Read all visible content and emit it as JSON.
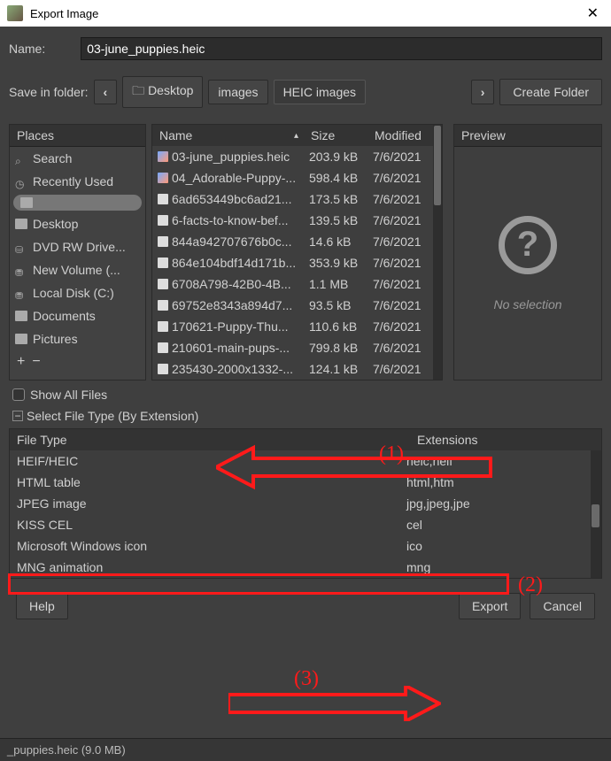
{
  "window": {
    "title": "Export Image"
  },
  "name_label": "Name:",
  "name_value": "03-june_puppies.heic",
  "savein_label": "Save in folder:",
  "breadcrumbs": [
    "Desktop",
    "images",
    "HEIC images"
  ],
  "create_folder": "Create Folder",
  "places_header": "Places",
  "places": [
    {
      "icon": "search",
      "label": "Search"
    },
    {
      "icon": "clock",
      "label": "Recently Used"
    },
    {
      "icon": "folder",
      "label": ""
    },
    {
      "icon": "folder",
      "label": "Desktop"
    },
    {
      "icon": "disk",
      "label": "DVD RW Drive..."
    },
    {
      "icon": "drive",
      "label": "New Volume (..."
    },
    {
      "icon": "drive",
      "label": "Local Disk (C:)"
    },
    {
      "icon": "folder",
      "label": "Documents"
    },
    {
      "icon": "folder",
      "label": "Pictures"
    }
  ],
  "file_headers": {
    "name": "Name",
    "size": "Size",
    "modified": "Modified"
  },
  "files": [
    {
      "icon": "img",
      "name": "03-june_puppies.heic",
      "size": "203.9 kB",
      "modified": "7/6/2021"
    },
    {
      "icon": "img",
      "name": "04_Adorable-Puppy-...",
      "size": "598.4 kB",
      "modified": "7/6/2021"
    },
    {
      "icon": "file",
      "name": "6ad653449bc6ad21...",
      "size": "173.5 kB",
      "modified": "7/6/2021"
    },
    {
      "icon": "file",
      "name": "6-facts-to-know-bef...",
      "size": "139.5 kB",
      "modified": "7/6/2021"
    },
    {
      "icon": "file",
      "name": "844a942707676b0c...",
      "size": "14.6 kB",
      "modified": "7/6/2021"
    },
    {
      "icon": "file",
      "name": "864e104bdf14d171b...",
      "size": "353.9 kB",
      "modified": "7/6/2021"
    },
    {
      "icon": "file",
      "name": "6708A798-42B0-4B...",
      "size": "1.1 MB",
      "modified": "7/6/2021"
    },
    {
      "icon": "file",
      "name": "69752e8343a894d7...",
      "size": "93.5 kB",
      "modified": "7/6/2021"
    },
    {
      "icon": "file",
      "name": "170621-Puppy-Thu...",
      "size": "110.6 kB",
      "modified": "7/6/2021"
    },
    {
      "icon": "file",
      "name": "210601-main-pups-...",
      "size": "799.8 kB",
      "modified": "7/6/2021"
    },
    {
      "icon": "file",
      "name": "235430-2000x1332-...",
      "size": "124.1 kB",
      "modified": "7/6/2021"
    }
  ],
  "preview_header": "Preview",
  "no_selection": "No selection",
  "show_all": "Show All Files",
  "select_type": "Select File Type (By Extension)",
  "type_headers": {
    "type": "File Type",
    "ext": "Extensions"
  },
  "types": [
    {
      "name": "HEIF/HEIC",
      "ext": "heic,heif"
    },
    {
      "name": "HTML table",
      "ext": "html,htm"
    },
    {
      "name": "JPEG image",
      "ext": "jpg,jpeg,jpe"
    },
    {
      "name": "KISS CEL",
      "ext": "cel"
    },
    {
      "name": "Microsoft Windows icon",
      "ext": "ico"
    },
    {
      "name": "MNG animation",
      "ext": "mng"
    }
  ],
  "buttons": {
    "help": "Help",
    "export": "Export",
    "cancel": "Cancel"
  },
  "statusbar": "_puppies.heic (9.0 MB)",
  "annotations": {
    "n1": "(1)",
    "n2": "(2)",
    "n3": "(3)"
  }
}
